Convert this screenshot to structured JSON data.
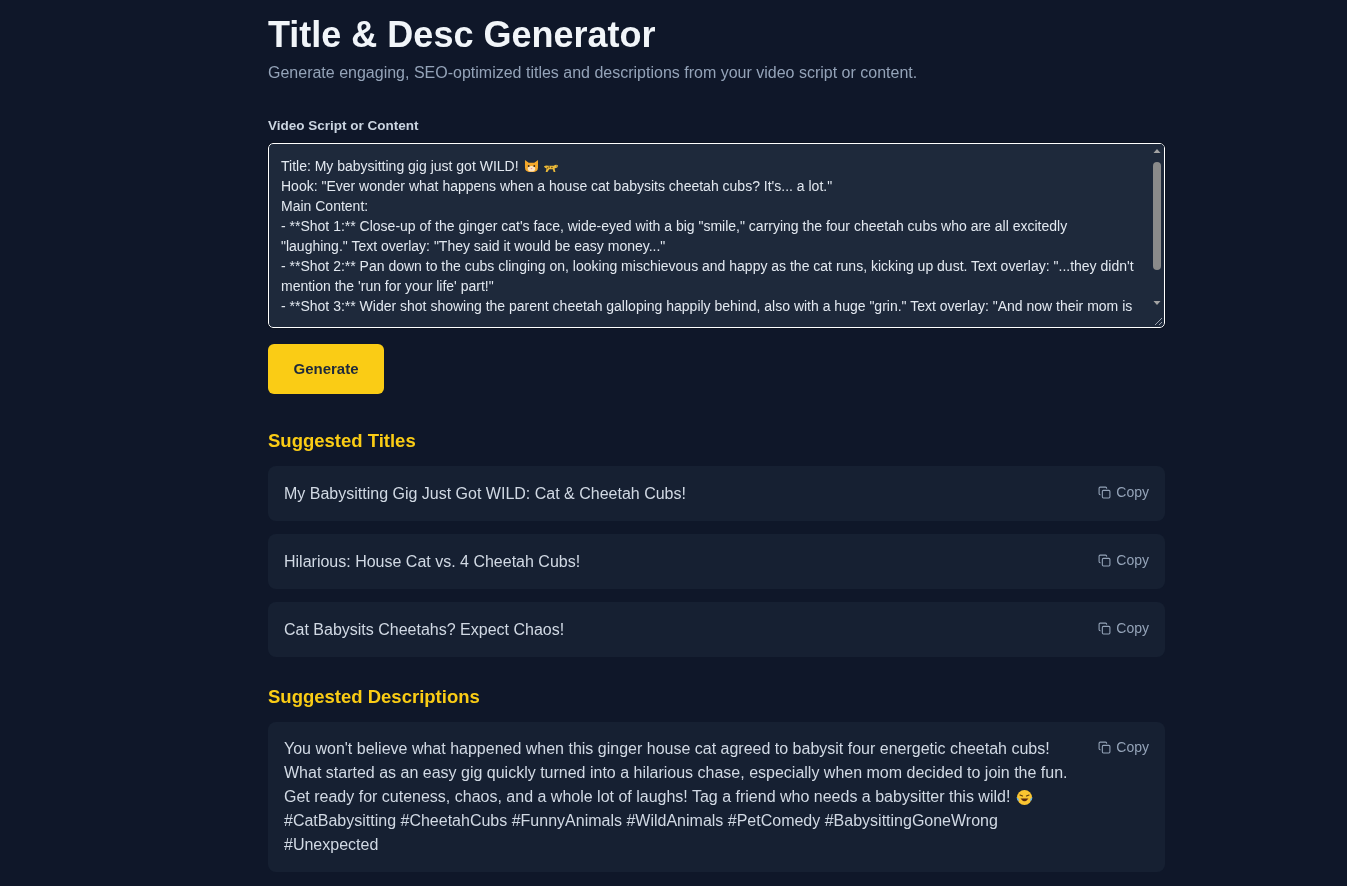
{
  "header": {
    "title": "Title & Desc Generator",
    "subtitle": "Generate engaging, SEO-optimized titles and descriptions from your video script or content."
  },
  "script_field": {
    "label": "Video Script or Content",
    "focused": true,
    "lines": [
      "Title: My babysitting gig just got WILD!",
      "Hook: \"Ever wonder what happens when a house cat babysits cheetah cubs? It's... a lot.\"",
      "Main Content:",
      "- **Shot 1:** Close-up of the ginger cat's face, wide-eyed with a big \"smile,\" carrying the four cheetah cubs who are all excitedly",
      "\"laughing.\" Text overlay: \"They said it would be easy money...\"",
      "- **Shot 2:** Pan down to the cubs clinging on, looking mischievous and happy as the cat runs, kicking up dust. Text overlay: \"...they didn't",
      "mention the 'run for your life' part!\"",
      "- **Shot 3:** Wider shot showing the parent cheetah galloping happily behind, also with a huge \"grin.\" Text overlay: \"And now their mom is"
    ]
  },
  "generate_button": "Generate",
  "titles_section": {
    "heading": "Suggested Titles",
    "items": [
      {
        "text": "My Babysitting Gig Just Got WILD: Cat & Cheetah Cubs!",
        "copy_label": "Copy"
      },
      {
        "text": "Hilarious: House Cat vs. 4 Cheetah Cubs!",
        "copy_label": "Copy"
      },
      {
        "text": "Cat Babysits Cheetahs? Expect Chaos!",
        "copy_label": "Copy"
      }
    ]
  },
  "descriptions_section": {
    "heading": "Suggested Descriptions",
    "items": [
      {
        "lines": [
          "You won't believe what happened when this ginger house cat agreed to babysit four energetic cheetah cubs!",
          "What started as an easy gig quickly turned into a hilarious chase, especially when mom decided to join the fun.",
          "Get ready for cuteness, chaos, and a whole lot of laughs! Tag a friend who needs a babysitter this wild!"
        ],
        "hashtags": "#CatBabysitting #CheetahCubs #FunnyAnimals #WildAnimals #PetComedy #BabysittingGoneWrong #Unexpected",
        "copy_label": "Copy"
      }
    ]
  }
}
